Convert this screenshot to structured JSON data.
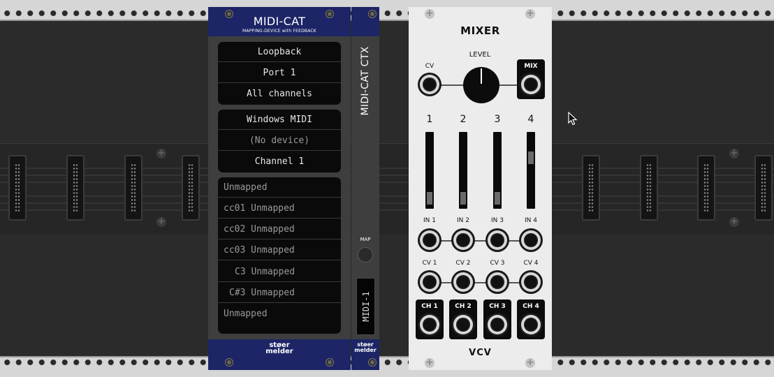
{
  "midicat": {
    "title": "MIDI-CAT",
    "subtitle": "MAPPING-DEVICE with FEEDBACK",
    "input": {
      "driver": "Loopback",
      "device": "Port 1",
      "channel": "All channels"
    },
    "output": {
      "driver": "Windows MIDI",
      "device": "(No device)",
      "channel": "Channel 1"
    },
    "mappings": [
      "Unmapped",
      "cc01 Unmapped",
      "cc02 Unmapped",
      "cc03 Unmapped",
      "C3 Unmapped",
      "C#3 Unmapped",
      "Unmapped"
    ],
    "brand_line1": "støer",
    "brand_line2": "melder"
  },
  "ctx": {
    "title": "MIDI-CAT CTX",
    "map_label": "MAP",
    "display": "MIDI-1",
    "brand_line1": "støer",
    "brand_line2": "melder"
  },
  "mixer": {
    "title": "MIXER",
    "level_label": "LEVEL",
    "cv_label": "CV",
    "mix_label": "MIX",
    "channel_numbers": [
      "1",
      "2",
      "3",
      "4"
    ],
    "slider_levels": [
      0.05,
      0.05,
      0.05,
      0.7
    ],
    "inputs": [
      "IN 1",
      "IN 2",
      "IN 3",
      "IN 4"
    ],
    "cv_inputs": [
      "CV 1",
      "CV 2",
      "CV 3",
      "CV 4"
    ],
    "outputs": [
      "CH 1",
      "CH 2",
      "CH 3",
      "CH 4"
    ],
    "logo": "VCV"
  },
  "colors": {
    "stoermelder_blue": "#1d2566",
    "panel_dark": "#3e3e3e",
    "mixer_panel": "#ececec"
  },
  "icons": [
    "screw-icon",
    "jack-icon",
    "cursor-icon",
    "plus-screw-icon"
  ]
}
